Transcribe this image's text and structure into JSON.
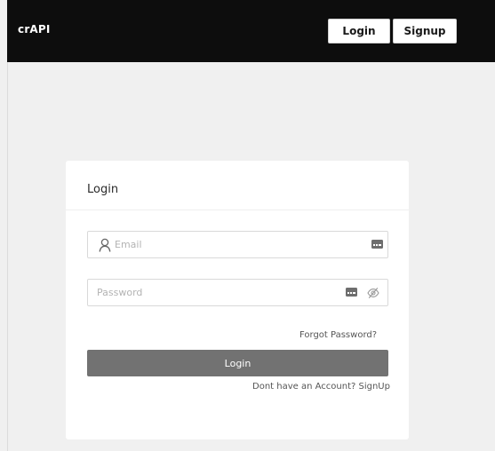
{
  "header": {
    "brand": "crAPI",
    "login_label": "Login",
    "signup_label": "Signup"
  },
  "login_card": {
    "title": "Login",
    "email": {
      "placeholder": "Email",
      "value": ""
    },
    "password": {
      "placeholder": "Password",
      "value": ""
    },
    "forgot_password": "Forgot Password?",
    "submit_label": "Login",
    "signup_prompt": "Dont have an Account? SignUp"
  },
  "icons": {
    "email_field": [
      "user-icon",
      "autofill-icon"
    ],
    "password_field": [
      "autofill-icon",
      "eye-slash-icon"
    ]
  },
  "colors": {
    "header_bg": "#0d0d0d",
    "page_bg": "#f0f0f0",
    "card_bg": "#ffffff",
    "submit_bg": "#727272"
  }
}
